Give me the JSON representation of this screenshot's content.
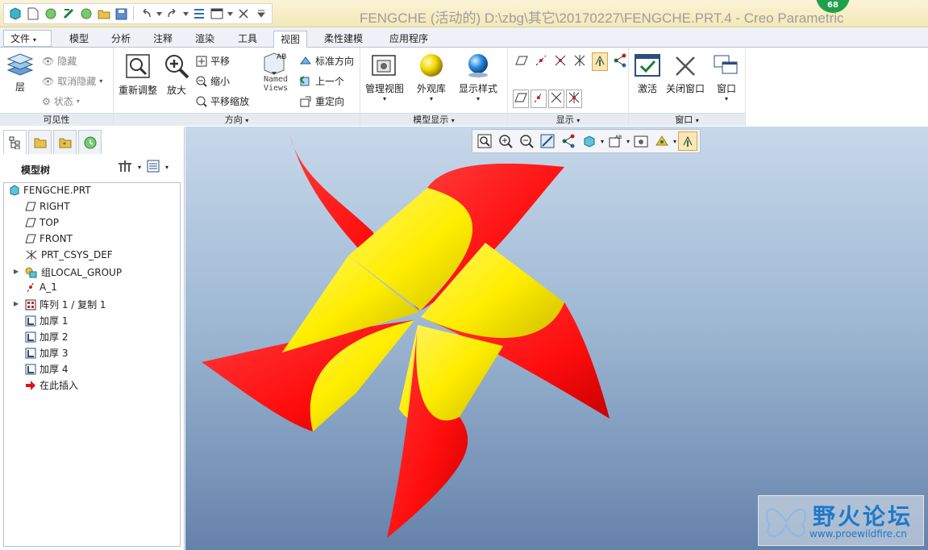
{
  "window": {
    "title": "FENGCHE (活动的) D:\\zbg\\其它\\20170227\\FENGCHE.PRT.4 - Creo Parametric",
    "badge": "68"
  },
  "menu_tabs": [
    {
      "label": "文件"
    },
    {
      "label": "模型"
    },
    {
      "label": "分析"
    },
    {
      "label": "注释"
    },
    {
      "label": "渲染"
    },
    {
      "label": "工具"
    },
    {
      "label": "视图"
    },
    {
      "label": "柔性建模"
    },
    {
      "label": "应用程序"
    }
  ],
  "active_tab": "视图",
  "ribbon": {
    "visibility": {
      "layer": "层",
      "hide": "隐藏",
      "unhide": "取消隐藏",
      "status": "状态",
      "footer": "可见性"
    },
    "orientation": {
      "refit": "重新调整",
      "zoom_in": "放大",
      "pan": "平移",
      "zoom_out": "缩小",
      "pan_zoom": "平移缩放",
      "named_views_1": "Named",
      "named_views_2": "Views",
      "standard": "标准方向",
      "previous": "上一个",
      "reorient": "重定向",
      "footer": "方向"
    },
    "model_display": {
      "manage": "管理视图",
      "appearance": "外观库",
      "style": "显示样式",
      "footer": "模型显示"
    },
    "show": {
      "footer": "显示"
    },
    "window": {
      "activate": "激活",
      "close": "关闭窗口",
      "windows": "窗口",
      "footer": "窗口"
    }
  },
  "model_tree": {
    "title": "模型树",
    "items": [
      {
        "label": "FENGCHE.PRT",
        "icon": "part-icon"
      },
      {
        "label": "RIGHT",
        "icon": "datum-plane-icon"
      },
      {
        "label": "TOP",
        "icon": "datum-plane-icon"
      },
      {
        "label": "FRONT",
        "icon": "datum-plane-icon"
      },
      {
        "label": "PRT_CSYS_DEF",
        "icon": "csys-icon"
      },
      {
        "label": "组LOCAL_GROUP",
        "icon": "group-icon"
      },
      {
        "label": "A_1",
        "icon": "axis-icon"
      },
      {
        "label": "阵列 1 / 复制 1",
        "icon": "pattern-icon"
      },
      {
        "label": "加厚 1",
        "icon": "thicken-icon"
      },
      {
        "label": "加厚 2",
        "icon": "thicken-icon"
      },
      {
        "label": "加厚 3",
        "icon": "thicken-icon"
      },
      {
        "label": "加厚 4",
        "icon": "thicken-icon"
      },
      {
        "label": "在此插入",
        "icon": "insert-here-icon"
      }
    ]
  },
  "watermark": {
    "title": "野火论坛",
    "url": "www.proewildfire.cn"
  },
  "colors": {
    "pinwheel_red": "#ff1a1a",
    "pinwheel_yellow": "#ffee00",
    "ribbon_footer": "#e6ebf1",
    "accent": "#1d79c9"
  }
}
